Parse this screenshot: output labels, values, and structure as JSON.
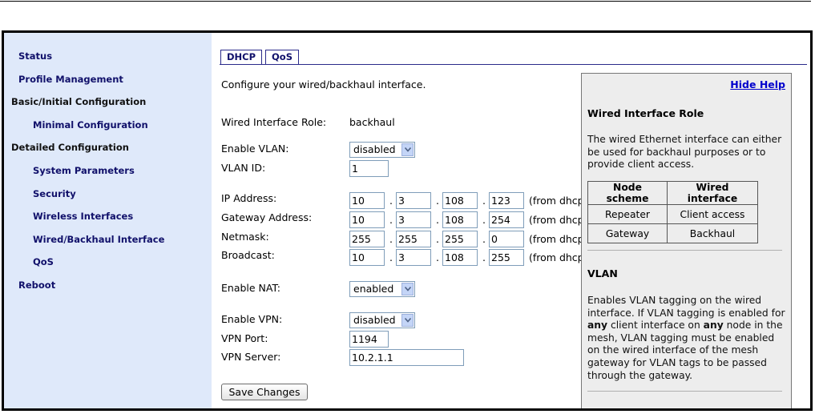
{
  "sidebar": {
    "items": [
      {
        "label": "Status",
        "type": "link"
      },
      {
        "label": "Profile Management",
        "type": "link"
      },
      {
        "label": "Basic/Initial Configuration",
        "type": "header"
      },
      {
        "label": "Minimal Configuration",
        "type": "link"
      },
      {
        "label": "Detailed Configuration",
        "type": "header"
      },
      {
        "label": "System Parameters",
        "type": "link"
      },
      {
        "label": "Security",
        "type": "link"
      },
      {
        "label": "Wireless Interfaces",
        "type": "link"
      },
      {
        "label": "Wired/Backhaul Interface",
        "type": "link"
      },
      {
        "label": "QoS",
        "type": "link"
      },
      {
        "label": "Reboot",
        "type": "link"
      }
    ]
  },
  "tabs": [
    {
      "label": "DHCP"
    },
    {
      "label": "QoS"
    }
  ],
  "form": {
    "intro": "Configure your wired/backhaul interface.",
    "role_label": "Wired Interface Role:",
    "role_value": "backhaul",
    "vlan_label": "Enable VLAN:",
    "vlan_value": "disabled",
    "vlan_id_label": "VLAN ID:",
    "vlan_id_value": "1",
    "ip_label": "IP Address:",
    "ip": [
      "10",
      "3",
      "108",
      "123"
    ],
    "gateway_label": "Gateway Address:",
    "gateway": [
      "10",
      "3",
      "108",
      "254"
    ],
    "netmask_label": "Netmask:",
    "netmask": [
      "255",
      "255",
      "255",
      "0"
    ],
    "broadcast_label": "Broadcast:",
    "broadcast": [
      "10",
      "3",
      "108",
      "255"
    ],
    "from_dhcp": "(from dhcp",
    "dot": ".",
    "nat_label": "Enable NAT:",
    "nat_value": "enabled",
    "vpn_label": "Enable VPN:",
    "vpn_value": "disabled",
    "vpn_port_label": "VPN Port:",
    "vpn_port_value": "1194",
    "vpn_server_label": "VPN Server:",
    "vpn_server_value": "10.2.1.1",
    "save_label": "Save Changes"
  },
  "help": {
    "hide_label": "Hide Help",
    "role_heading": "Wired Interface Role",
    "role_text": "The wired Ethernet interface can either be used for backhaul purposes or to provide client access.",
    "table": {
      "headers": [
        "Node scheme",
        "Wired interface"
      ],
      "rows": [
        [
          "Repeater",
          "Client access"
        ],
        [
          "Gateway",
          "Backhaul"
        ]
      ]
    },
    "vlan_heading": "VLAN",
    "vlan_text_html_parts": {
      "a": "Enables VLAN tagging on the wired interface. If VLAN tagging is enabled for ",
      "b": "any",
      "c": " client interface on ",
      "d": "any",
      "e": " node in the mesh, VLAN tagging must be enabled on the wired interface of the mesh gateway for VLAN tags to be passed through the gateway."
    }
  },
  "colors": {
    "sidebar_bg": "#dfe9fa",
    "nav_link": "#10106a",
    "help_bg": "#ededed",
    "help_link": "#0000cc"
  }
}
